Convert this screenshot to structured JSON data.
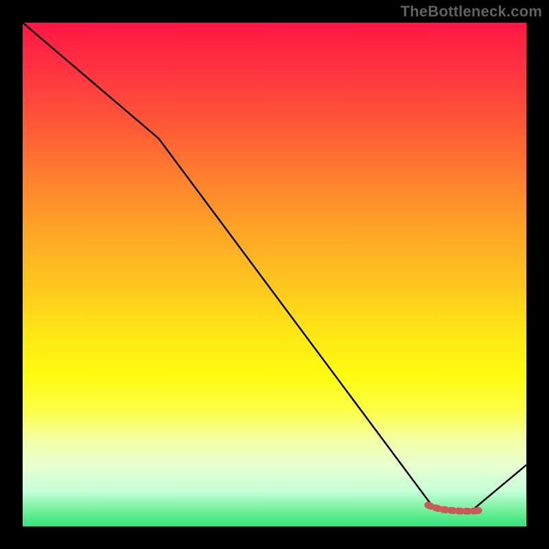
{
  "watermark": "TheBottleneck.com",
  "colors": {
    "line": "#000000",
    "marker": "#cc5959"
  },
  "chart_data": {
    "type": "line",
    "title": "",
    "xlabel": "",
    "ylabel": "",
    "xlim": [
      0,
      100
    ],
    "ylim": [
      0,
      100
    ],
    "grid": false,
    "series": [
      {
        "name": "main",
        "x": [
          0,
          27,
          81.5,
          89,
          100
        ],
        "y": [
          100,
          77,
          3.8,
          3.0,
          12.2
        ]
      }
    ],
    "marker_series": {
      "name": "bottom-segment",
      "style": "thick-dash-round",
      "x": [
        80,
        81.5,
        83,
        84.5,
        86,
        87.5,
        89,
        91
      ],
      "y": [
        4.4,
        3.8,
        3.4,
        3.2,
        3.1,
        3.0,
        3.0,
        3.2
      ]
    }
  }
}
